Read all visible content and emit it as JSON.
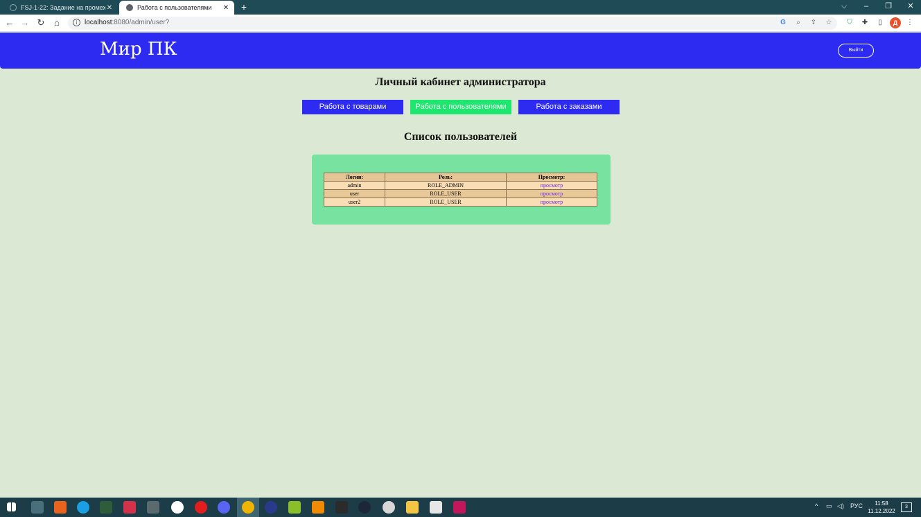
{
  "browser": {
    "tabs": [
      {
        "title": "FSJ-1-22: Задание на промежут",
        "active": false
      },
      {
        "title": "Работа с пользователями",
        "active": true
      }
    ],
    "new_tab": "+",
    "window_controls": {
      "collapse": "⌵",
      "minimize": "–",
      "restore": "❐",
      "close": "✕"
    },
    "url_host": "localhost",
    "url_rest": ":8080/admin/user?",
    "profile_initial": "Д",
    "icons": [
      "back-icon",
      "forward-icon",
      "reload-icon",
      "home-icon",
      "info-icon",
      "google-icon",
      "zoom-icon",
      "share-icon",
      "star-icon",
      "shield-extension-icon",
      "puzzle-icon",
      "sidepanel-icon",
      "menu-icon"
    ]
  },
  "header": {
    "brand": "Мир ПК",
    "logout_label": "Выйти",
    "bg_color": "#2d2af2"
  },
  "main": {
    "title": "Личный кабинет администратора",
    "menu": [
      {
        "label": "Работа с товарами",
        "active": false
      },
      {
        "label": "Работа с пользователями",
        "active": true
      },
      {
        "label": "Работа с заказами",
        "active": false
      }
    ],
    "list_title": "Список пользователей",
    "table": {
      "headers": [
        "Логин:",
        "Роль:",
        "Просмотр:"
      ],
      "rows": [
        {
          "login": "admin",
          "role": "ROLE_ADMIN",
          "view": "просмотр"
        },
        {
          "login": "user",
          "role": "ROLE_USER",
          "view": "просмотр"
        },
        {
          "login": "user2",
          "role": "ROLE_USER",
          "view": "просмотр"
        }
      ]
    }
  },
  "taskbar": {
    "language": "РУС",
    "time": "11:58",
    "date": "11.12.2022",
    "notifications": "3"
  }
}
